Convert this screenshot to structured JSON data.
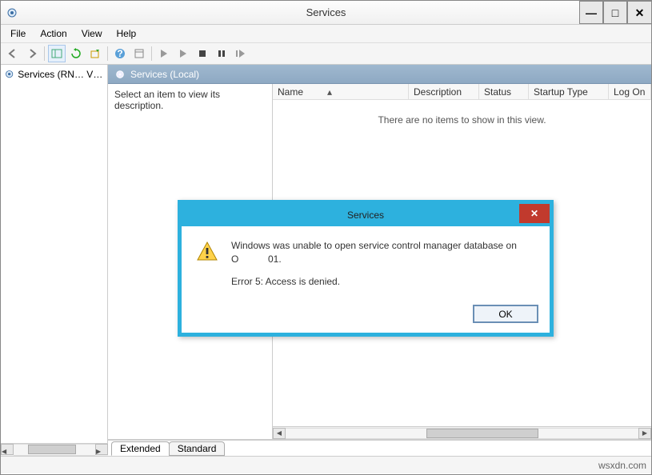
{
  "window": {
    "title": "Services"
  },
  "menu": {
    "file": "File",
    "action": "Action",
    "view": "View",
    "help": "Help"
  },
  "tree": {
    "root": "Services (RN… VI…)"
  },
  "panel": {
    "header": "Services (Local)",
    "desc_prompt": "Select an item to view its description.",
    "columns": {
      "name": "Name",
      "description": "Description",
      "status": "Status",
      "startup": "Startup Type",
      "logon": "Log On"
    },
    "empty": "There are no items to show in this view."
  },
  "tabs": {
    "extended": "Extended",
    "standard": "Standard"
  },
  "dialog": {
    "title": "Services",
    "line1": "Windows was unable to open service control manager database on",
    "line2": "O           01.",
    "line3": "Error 5: Access is denied.",
    "ok": "OK"
  },
  "status": {
    "watermark": "wsxdn.com"
  }
}
